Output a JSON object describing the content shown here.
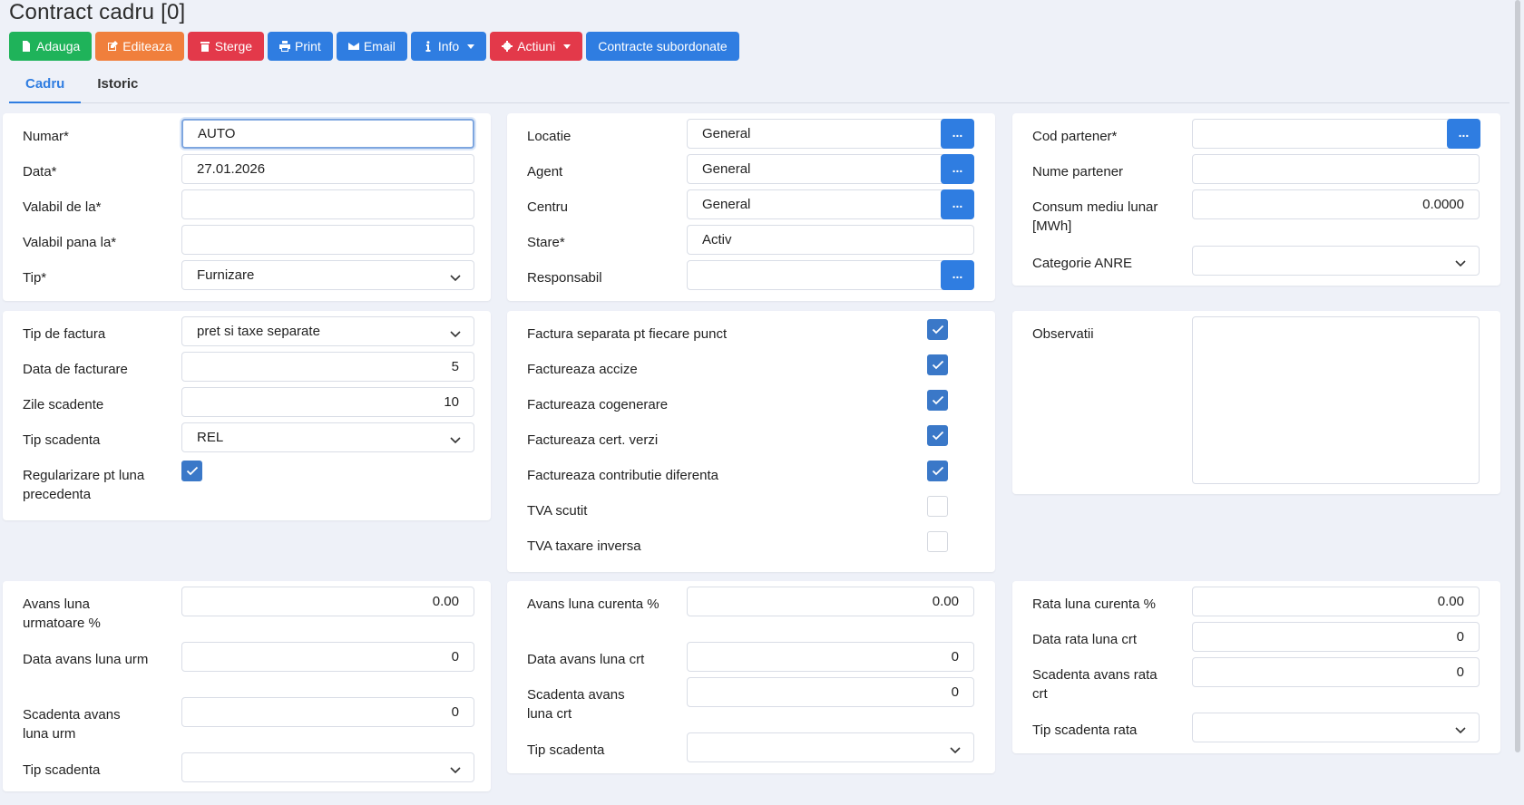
{
  "page": {
    "title": "Contract cadru [0]"
  },
  "colors": {
    "green": "#1fb35a",
    "orange": "#f07f3c",
    "red": "#e3394a",
    "blue": "#2f7de1",
    "checkbox": "#3a78c8"
  },
  "toolbar": {
    "adauga": "Adauga",
    "editeaza": "Editeaza",
    "sterge": "Sterge",
    "print": "Print",
    "email": "Email",
    "info": "Info",
    "actiuni": "Actiuni",
    "subordonate": "Contracte subordonate"
  },
  "tabs": {
    "cadru": "Cadru",
    "istoric": "Istoric"
  },
  "general": {
    "numar_label": "Numar*",
    "numar": "AUTO",
    "data_label": "Data*",
    "data": "27.01.2026",
    "valabil_de_la_label": "Valabil de la*",
    "valabil_de_la": "",
    "valabil_pana_la_label": "Valabil pana la*",
    "valabil_pana_la": "",
    "tip_label": "Tip*",
    "tip": "Furnizare"
  },
  "location": {
    "locatie_label": "Locatie",
    "locatie": "General",
    "agent_label": "Agent",
    "agent": "General",
    "centru_label": "Centru",
    "centru": "General",
    "stare_label": "Stare*",
    "stare": "Activ",
    "responsabil_label": "Responsabil",
    "responsabil": "",
    "dots": "..."
  },
  "partner": {
    "cod_label": "Cod partener*",
    "cod": "",
    "nume_label": "Nume partener",
    "nume": "",
    "consum_label": "Consum mediu lunar [MWh]",
    "consum": "0.0000",
    "anre_label": "Categorie ANRE",
    "anre": ""
  },
  "billing": {
    "tip_factura_label": "Tip de factura",
    "tip_factura": "pret si taxe separate",
    "data_facturare_label": "Data de facturare",
    "data_facturare": "5",
    "zile_scadente_label": "Zile scadente",
    "zile_scadente": "10",
    "tip_scadenta_label": "Tip scadenta",
    "tip_scadenta": "REL",
    "regularizare_label": "Regularizare pt luna precedenta",
    "regularizare": true
  },
  "flags": [
    {
      "label": "Factura separata pt fiecare punct",
      "checked": true
    },
    {
      "label": "Factureaza accize",
      "checked": true
    },
    {
      "label": "Factureaza cogenerare",
      "checked": true
    },
    {
      "label": "Factureaza cert. verzi",
      "checked": true
    },
    {
      "label": "Factureaza contributie diferenta",
      "checked": true
    },
    {
      "label": "TVA scutit",
      "checked": false
    },
    {
      "label": "TVA taxare inversa",
      "checked": false
    }
  ],
  "notes": {
    "observatii_label": "Observatii",
    "observatii": ""
  },
  "advance_next": {
    "avans_label": "Avans luna urmatoare %",
    "avans": "0.00",
    "data_label": "Data avans luna urm",
    "data": "0",
    "scadenta_label": "Scadenta avans luna urm",
    "scadenta": "0",
    "tip_label": "Tip scadenta",
    "tip": ""
  },
  "advance_current": {
    "avans_label": "Avans luna curenta %",
    "avans": "0.00",
    "data_label": "Data avans luna crt",
    "data": "0",
    "scadenta_label": "Scadenta avans luna crt",
    "scadenta": "0",
    "tip_label": "Tip scadenta",
    "tip": ""
  },
  "rate": {
    "rata_label": "Rata luna curenta %",
    "rata": "0.00",
    "data_label": "Data rata luna crt",
    "data": "0",
    "scadenta_label": "Scadenta avans rata crt",
    "scadenta": "0",
    "tip_label": "Tip scadenta rata",
    "tip": ""
  }
}
